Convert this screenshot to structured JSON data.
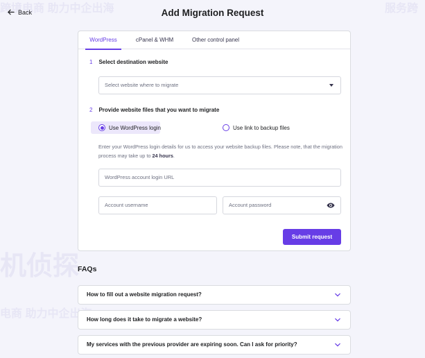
{
  "header": {
    "back_label": "Back",
    "title": "Add Migration Request"
  },
  "tabs": [
    {
      "label": "WordPress",
      "active": true
    },
    {
      "label": "cPanel & WHM",
      "active": false
    },
    {
      "label": "Other control panel",
      "active": false
    }
  ],
  "step1": {
    "number": "1",
    "title": "Select destination website",
    "select_placeholder": "Select website where to migrate"
  },
  "step2": {
    "number": "2",
    "title": "Provide website files that you want to migrate",
    "option_login": "Use WordPress login",
    "option_link": "Use link to backup files",
    "selected": "login",
    "info_text": "Enter your WordPress login details for us to access your website backup files. Please note, that the migration process may take up to ",
    "info_bold": "24 hours",
    "info_end": ".",
    "login_url_placeholder": "WordPress account login URL",
    "username_placeholder": "Account username",
    "password_placeholder": "Account password",
    "submit_label": "Submit request"
  },
  "faq": {
    "title": "FAQs",
    "items": [
      "How to fill out a website migration request?",
      "How long does it take to migrate a website?",
      "My services with the previous provider are expiring soon. Can I ask for priority?"
    ]
  },
  "watermark": {
    "text_a": "跨境电商 助力中企出海",
    "text_b": "服务跨",
    "text_c": "主机侦探",
    "text_d": "服务跨境电商 助力中企出海",
    "text_e": "电商 助力中企出海",
    "text_f": "机侦探"
  },
  "colors": {
    "accent": "#673de6",
    "text": "#1d1e20",
    "muted": "#6d7081",
    "bg": "#f4f4fb"
  }
}
